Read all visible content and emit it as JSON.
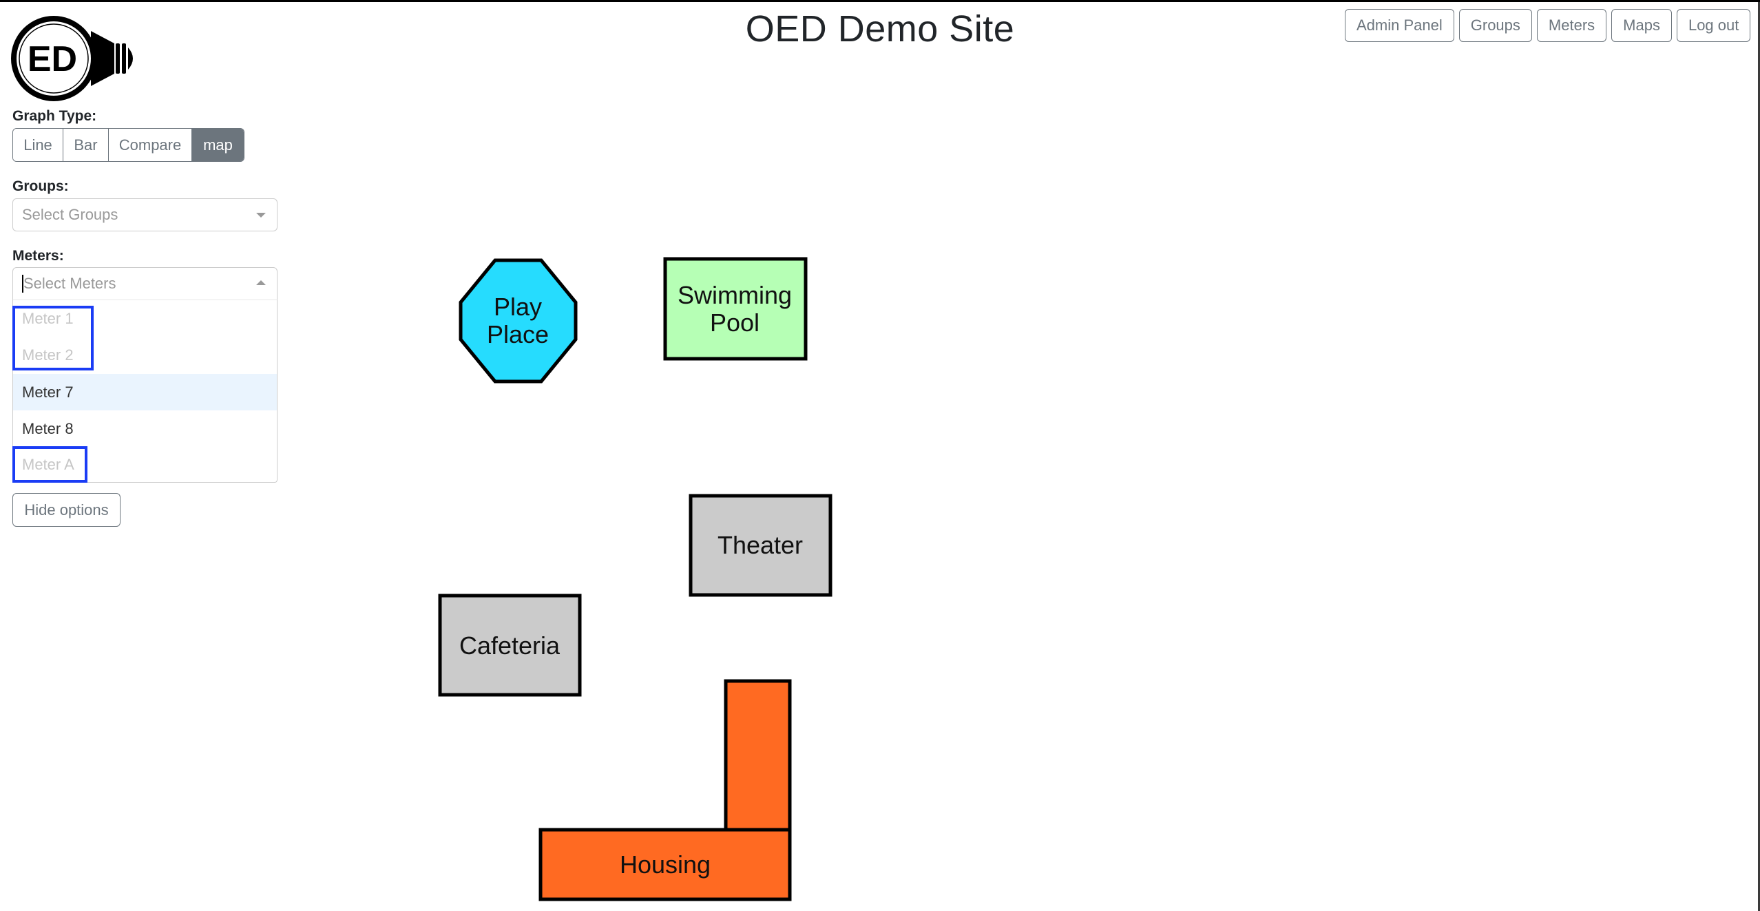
{
  "header": {
    "title": "OED Demo Site",
    "logo_text": "ED",
    "nav": [
      {
        "label": "Admin Panel"
      },
      {
        "label": "Groups"
      },
      {
        "label": "Meters"
      },
      {
        "label": "Maps"
      },
      {
        "label": "Log out"
      }
    ]
  },
  "sidebar": {
    "graph_type": {
      "label": "Graph Type:",
      "options": [
        {
          "label": "Line",
          "active": false
        },
        {
          "label": "Bar",
          "active": false
        },
        {
          "label": "Compare",
          "active": false
        },
        {
          "label": "map",
          "active": true
        }
      ]
    },
    "groups": {
      "label": "Groups:",
      "placeholder": "Select Groups"
    },
    "meters": {
      "label": "Meters:",
      "placeholder": "Select Meters",
      "menu_open": true,
      "options": [
        {
          "label": "Meter 1",
          "disabled": true,
          "focused": false,
          "outlined": true
        },
        {
          "label": "Meter 2",
          "disabled": true,
          "focused": false,
          "outlined": true
        },
        {
          "label": "Meter 7",
          "disabled": false,
          "focused": true,
          "outlined": false
        },
        {
          "label": "Meter 8",
          "disabled": false,
          "focused": false,
          "outlined": false
        },
        {
          "label": "Meter A",
          "disabled": true,
          "focused": false,
          "outlined": true
        }
      ]
    },
    "hide_options_label": "Hide options"
  },
  "map": {
    "buildings": [
      {
        "name": "Play Place",
        "lines": [
          "Play",
          "Place"
        ],
        "shape": "octagon",
        "color": "#26dcfe"
      },
      {
        "name": "Swimming Pool",
        "lines": [
          "Swimming",
          "Pool"
        ],
        "shape": "rectangle",
        "color": "#b6ffb5"
      },
      {
        "name": "Theater",
        "lines": [
          "Theater"
        ],
        "shape": "rectangle",
        "color": "#cbcbcb"
      },
      {
        "name": "Cafeteria",
        "lines": [
          "Cafeteria"
        ],
        "shape": "rectangle",
        "color": "#cbcbcb"
      },
      {
        "name": "Housing",
        "lines": [
          "Housing"
        ],
        "shape": "l-shape",
        "color": "#ff6a22"
      }
    ],
    "highlight_color": "#1a3cf5"
  }
}
